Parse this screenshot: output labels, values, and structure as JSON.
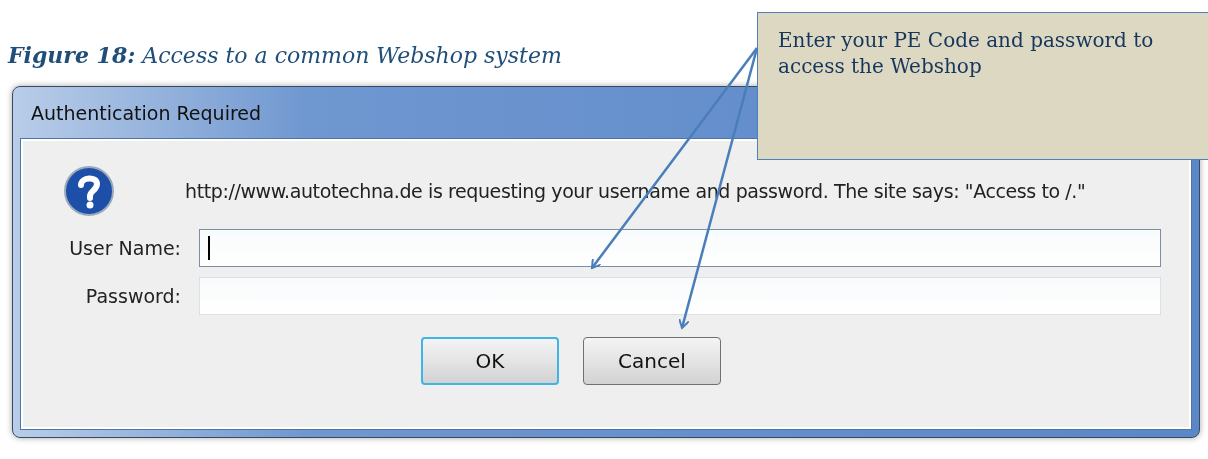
{
  "caption": "**Figure 18:** Access to a common Webshop system",
  "callout": {
    "text": "Enter your PE Code and password to access the Webshop"
  },
  "dialog": {
    "title": "Authentication Required",
    "message": "http://www.autotechna.de is requesting your username and password. The site says: \"Access to /.\"",
    "fields": [
      {
        "label": "User Name:",
        "focused": true
      },
      {
        "label": "Password:",
        "focused": false
      }
    ],
    "buttons": [
      {
        "label": "OK",
        "default": true
      },
      {
        "label": "Cancel",
        "default": false
      }
    ]
  }
}
